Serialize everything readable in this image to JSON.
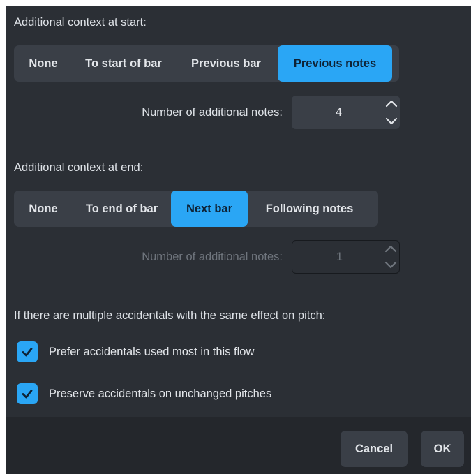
{
  "start_section": {
    "heading": "Additional context at start:",
    "options": [
      "None",
      "To start of bar",
      "Previous bar",
      "Previous notes"
    ],
    "selected": "Previous notes",
    "notes_label": "Number of additional notes:",
    "notes_value": "4"
  },
  "end_section": {
    "heading": "Additional context at end:",
    "options": [
      "None",
      "To end of bar",
      "Next bar",
      "Following notes"
    ],
    "selected": "Next bar",
    "notes_label": "Number of additional notes:",
    "notes_value": "1"
  },
  "accidentals": {
    "heading": "If there are multiple accidentals with the same effect on pitch:",
    "prefer_most_used": {
      "label": "Prefer accidentals used most in this flow",
      "checked": true
    },
    "preserve_unchanged": {
      "label": "Preserve accidentals on unchanged pitches",
      "checked": true
    }
  },
  "footer": {
    "cancel_label": "Cancel",
    "ok_label": "OK"
  },
  "colors": {
    "accent": "#2aa6f5",
    "panel": "#2b2f35",
    "control": "#3a3f47"
  }
}
